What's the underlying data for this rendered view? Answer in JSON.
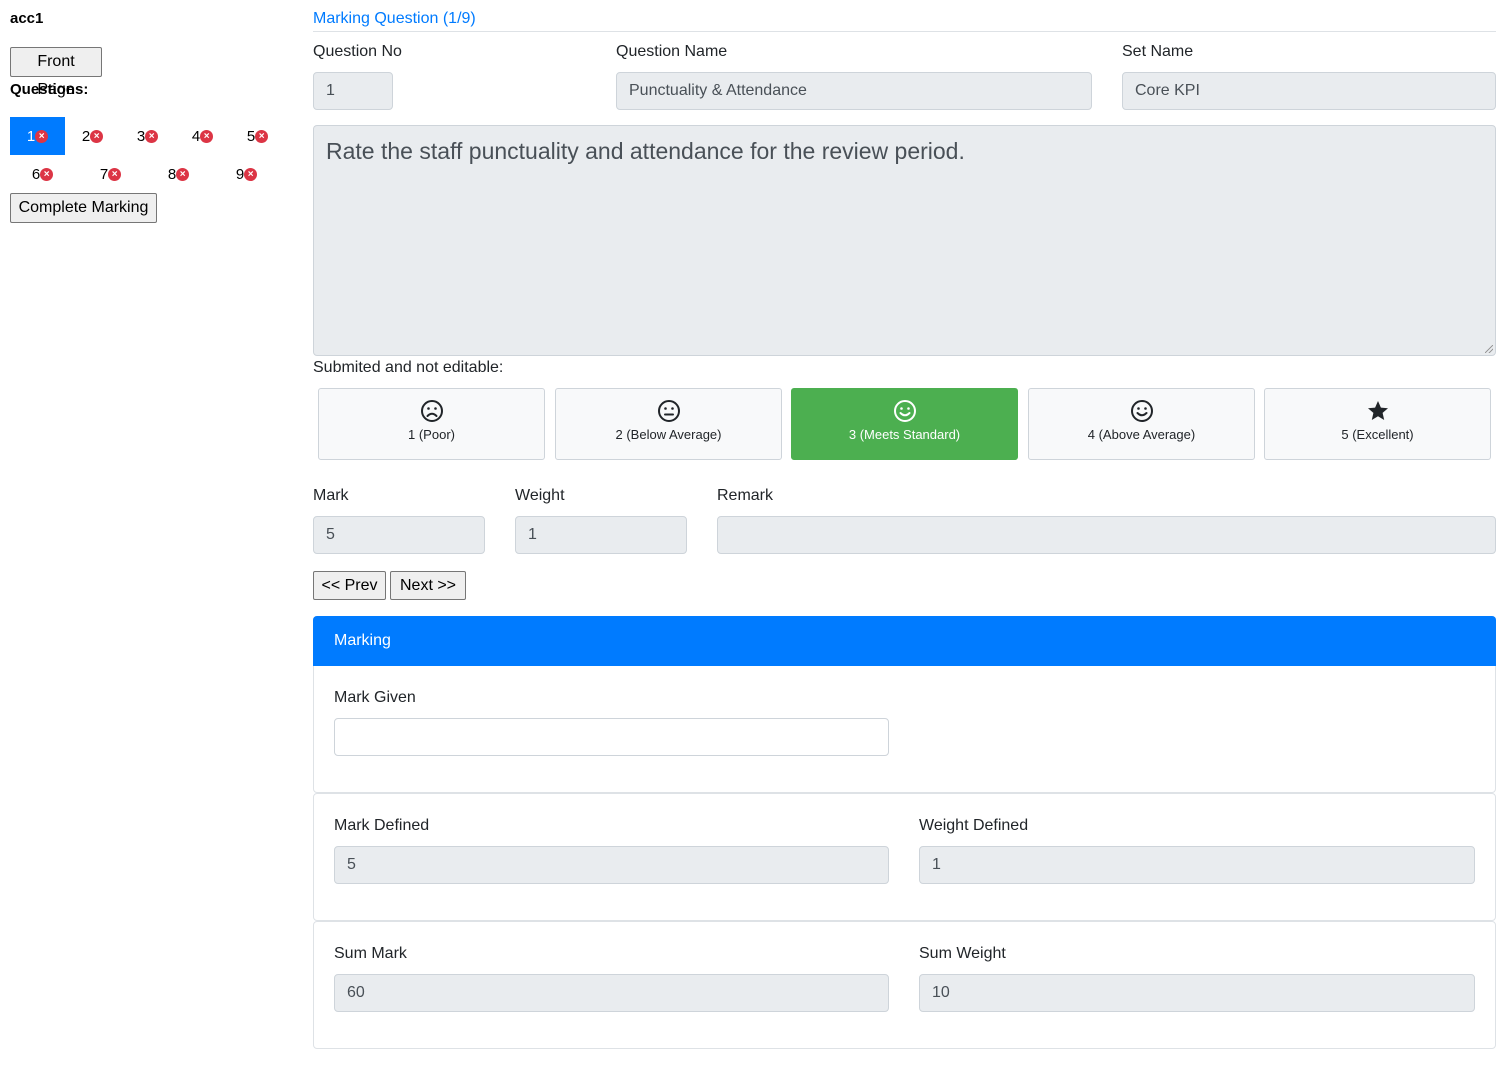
{
  "sidebar": {
    "user": "acc1",
    "front_page": "Front Page",
    "questions_label": "Questions:",
    "questions": [
      {
        "num": "1",
        "status": "×",
        "active": true
      },
      {
        "num": "2",
        "status": "×",
        "active": false
      },
      {
        "num": "3",
        "status": "×",
        "active": false
      },
      {
        "num": "4",
        "status": "×",
        "active": false
      },
      {
        "num": "5",
        "status": "×",
        "active": false
      },
      {
        "num": "6",
        "status": "×",
        "active": false
      },
      {
        "num": "7",
        "status": "×",
        "active": false
      },
      {
        "num": "8",
        "status": "×",
        "active": false
      },
      {
        "num": "9",
        "status": "×",
        "active": false
      }
    ],
    "complete": "Complete Marking"
  },
  "main": {
    "title": "Marking Question (1/9)",
    "question_no_label": "Question No",
    "question_no": "1",
    "question_name_label": "Question Name",
    "question_name": "Punctuality & Attendance",
    "set_name_label": "Set Name",
    "set_name": "Core KPI",
    "description": "Rate the staff punctuality and attendance for the review period.",
    "submitted_note": "Submited and not editable:",
    "ratings": [
      {
        "label": "1 (Poor)",
        "icon": "frown-icon",
        "selected": false
      },
      {
        "label": "2 (Below Average)",
        "icon": "neutral-face-icon",
        "selected": false
      },
      {
        "label": "3 (Meets Standard)",
        "icon": "smile-icon",
        "selected": true
      },
      {
        "label": "4 (Above Average)",
        "icon": "smile-icon",
        "selected": false
      },
      {
        "label": "5 (Excellent)",
        "icon": "star-icon",
        "selected": false
      }
    ],
    "mark_label": "Mark",
    "mark": "5",
    "weight_label": "Weight",
    "weight": "1",
    "remark_label": "Remark",
    "remark": "",
    "prev": "<< Prev",
    "next": "Next >>"
  },
  "marking": {
    "header": "Marking",
    "mark_given_label": "Mark Given",
    "mark_given": "",
    "mark_defined_label": "Mark Defined",
    "mark_defined": "5",
    "weight_defined_label": "Weight Defined",
    "weight_defined": "1",
    "sum_mark_label": "Sum Mark",
    "sum_mark": "60",
    "sum_weight_label": "Sum Weight",
    "sum_weight": "10"
  },
  "colors": {
    "primary": "#007bff",
    "selected_rating": "#4caf50",
    "error_badge": "#dc3545"
  }
}
